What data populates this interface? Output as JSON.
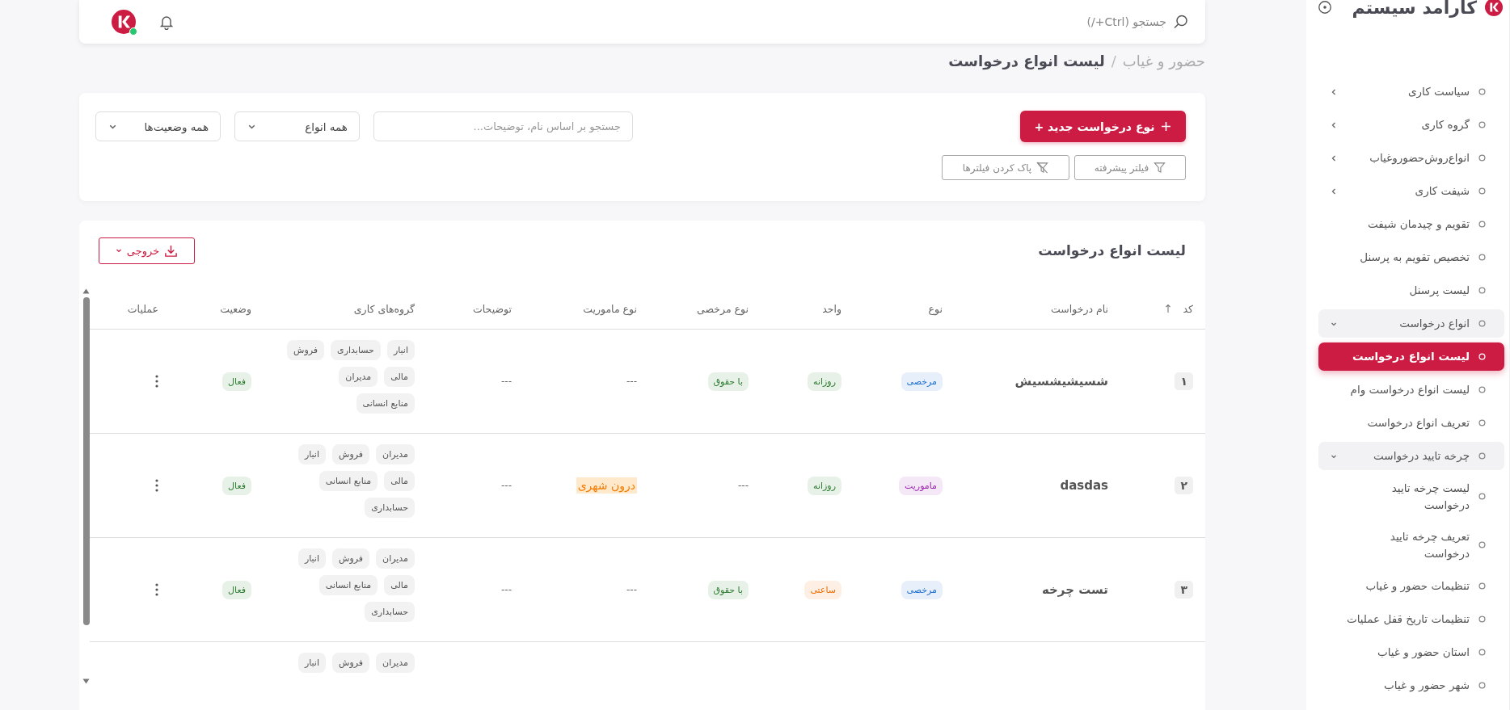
{
  "sidebar": {
    "brand": "کارامد سیستم",
    "items": [
      {
        "kind": "group",
        "label": "سیاست کاری",
        "selected": false,
        "expanded": false
      },
      {
        "kind": "group",
        "label": "گروه کاری",
        "selected": false,
        "expanded": false
      },
      {
        "kind": "group",
        "label": "انواع‌روش‌حضوروغیاب",
        "selected": false,
        "expanded": false
      },
      {
        "kind": "group",
        "label": "شیفت کاری",
        "selected": false,
        "expanded": false
      },
      {
        "kind": "link",
        "label": "تقویم و چیدمان شیفت",
        "selected": false
      },
      {
        "kind": "link",
        "label": "تخصیص تقویم به پرسنل",
        "selected": false
      },
      {
        "kind": "link",
        "label": "لیست پرسنل",
        "selected": false
      },
      {
        "kind": "group",
        "label": "انواع درخواست",
        "selected": false,
        "expanded": true,
        "children": [
          {
            "kind": "link",
            "label": "لیست انواع درخواست",
            "selected": true
          },
          {
            "kind": "link",
            "label": "لیست انواع درخواست وام",
            "selected": false
          },
          {
            "kind": "link",
            "label": "تعریف انواع درخواست",
            "selected": false
          }
        ]
      },
      {
        "kind": "group",
        "label": "چرخه تایید درخواست",
        "selected": false,
        "expanded": true,
        "children": [
          {
            "kind": "link",
            "label": "لیست چرخه تایید درخواست",
            "selected": false
          },
          {
            "kind": "link",
            "label": "تعریف چرخه تایید درخواست",
            "selected": false
          }
        ]
      },
      {
        "kind": "link",
        "label": "تنظیمات حضور و غیاب",
        "selected": false
      },
      {
        "kind": "link",
        "label": "تنظیمات تاریخ قفل عملیات",
        "selected": false
      },
      {
        "kind": "link",
        "label": "استان حضور و غیاب",
        "selected": false
      },
      {
        "kind": "link",
        "label": "شهر حضور و غیاب",
        "selected": false
      }
    ]
  },
  "topbar": {
    "search": {
      "placeholder": "جستجو (Ctrl+/)"
    }
  },
  "breadcrumb": {
    "separator": "/",
    "items": [
      {
        "label": "حضور و غیاب",
        "current": false
      },
      {
        "label": "لیست انواع درخواست",
        "current": true
      }
    ]
  },
  "filters": {
    "new_button": "نوع درخواست جدید +",
    "search": {
      "placeholder": "جستجو بر اساس نام، توضیحات..."
    },
    "selects": [
      {
        "value": "همه انواع"
      },
      {
        "value": "همه وضعیت‌ها"
      }
    ],
    "buttons": [
      {
        "kind": "filter",
        "label": "فیلتر پیشرفته"
      },
      {
        "kind": "clear",
        "label": "پاک کردن فیلترها"
      }
    ]
  },
  "table": {
    "title": "لیست انواع درخواست",
    "export_button": "خروجی",
    "columns": [
      {
        "label": "کد",
        "sorted": true
      },
      {
        "label": "نام درخواست",
        "sorted": false
      },
      {
        "label": "نوع",
        "sorted": false
      },
      {
        "label": "واحد",
        "sorted": false
      },
      {
        "label": "نوع مرخصی",
        "sorted": false
      },
      {
        "label": "نوع ماموریت",
        "sorted": false
      },
      {
        "label": "توضیحات",
        "sorted": false
      },
      {
        "label": "گروه‌های کاری",
        "sorted": false
      },
      {
        "label": "وضعیت",
        "sorted": false
      },
      {
        "label": "عملیات",
        "sorted": false
      }
    ],
    "rows": [
      {
        "cells": [
          {
            "kind": "code",
            "text": "۱"
          },
          {
            "kind": "name",
            "text": "شسیشیشسیش"
          },
          {
            "kind": "badge",
            "text": "مرخصی",
            "color": "#1e6fd0"
          },
          {
            "kind": "badge",
            "text": "روزانه",
            "color": "#2e7d32"
          },
          {
            "kind": "badge",
            "text": "با حقوق",
            "color": "#2e7d32"
          },
          {
            "kind": "plain",
            "text": "---"
          },
          {
            "kind": "plain",
            "text": "---"
          },
          {
            "kind": "tags",
            "lines": [
              [
                "انبار",
                "حسابداری",
                "فروش"
              ],
              [
                "مالی",
                "مدیران"
              ],
              [
                "منابع انسانی"
              ]
            ]
          },
          {
            "kind": "badge",
            "text": "فعال",
            "color": "#2e7d32"
          },
          {
            "kind": "menu"
          }
        ]
      },
      {
        "cells": [
          {
            "kind": "code",
            "text": "۲"
          },
          {
            "kind": "name",
            "text": "dasdas"
          },
          {
            "kind": "badge",
            "text": "ماموریت",
            "color": "#9c27b0"
          },
          {
            "kind": "badge",
            "text": "روزانه",
            "color": "#2e7d32"
          },
          {
            "kind": "plain",
            "text": "---"
          },
          {
            "kind": "highlight",
            "text": "درون شهری",
            "color": "#f57c00"
          },
          {
            "kind": "plain",
            "text": "---"
          },
          {
            "kind": "tags",
            "lines": [
              [
                "مدیران",
                "فروش",
                "انبار"
              ],
              [
                "مالی",
                "منابع انسانی"
              ],
              [
                "حسابداری"
              ]
            ]
          },
          {
            "kind": "badge",
            "text": "فعال",
            "color": "#2e7d32"
          },
          {
            "kind": "menu"
          }
        ]
      },
      {
        "cells": [
          {
            "kind": "code",
            "text": "۳"
          },
          {
            "kind": "name",
            "text": "تست چرخه"
          },
          {
            "kind": "badge",
            "text": "مرخصی",
            "color": "#1e6fd0"
          },
          {
            "kind": "badge",
            "text": "ساعتی",
            "color": "#ef6c00"
          },
          {
            "kind": "badge",
            "text": "با حقوق",
            "color": "#2e7d32"
          },
          {
            "kind": "plain",
            "text": "---"
          },
          {
            "kind": "plain",
            "text": "---"
          },
          {
            "kind": "tags",
            "lines": [
              [
                "مدیران",
                "فروش",
                "انبار"
              ],
              [
                "مالی",
                "منابع انسانی"
              ],
              [
                "حسابداری"
              ]
            ]
          },
          {
            "kind": "badge",
            "text": "فعال",
            "color": "#2e7d32"
          },
          {
            "kind": "menu"
          }
        ]
      },
      {
        "cells": [
          null,
          null,
          null,
          null,
          null,
          null,
          null,
          {
            "kind": "tags",
            "lines": [
              [
                "مدیران",
                "فروش",
                "انبار"
              ]
            ]
          },
          null,
          null
        ]
      }
    ]
  }
}
